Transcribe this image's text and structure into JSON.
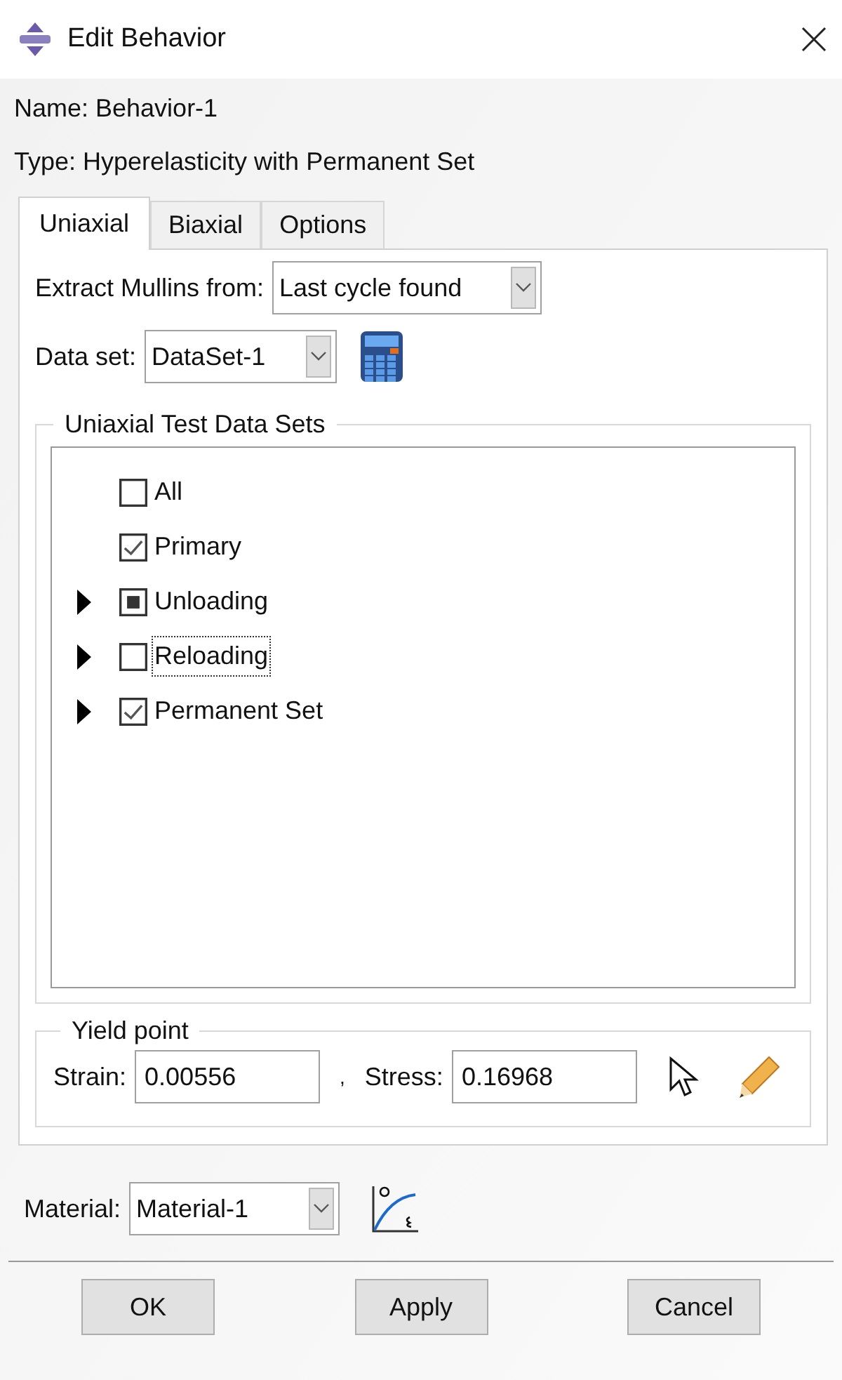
{
  "window": {
    "title": "Edit Behavior"
  },
  "name_line": "Name: Behavior-1",
  "type_line": "Type: Hyperelasticity with Permanent Set",
  "tabs": [
    {
      "label": "Uniaxial",
      "selected": true
    },
    {
      "label": "Biaxial",
      "selected": false
    },
    {
      "label": "Options",
      "selected": false
    }
  ],
  "extract": {
    "label": "Extract Mullins from:",
    "value": "Last cycle found"
  },
  "data_set": {
    "label": "Data set:",
    "value": "DataSet-1"
  },
  "test_data_sets": {
    "title": "Uniaxial Test Data Sets",
    "items": [
      {
        "label": "All",
        "checked": false,
        "partial": false,
        "expandable": false,
        "focused": false
      },
      {
        "label": "Primary",
        "checked": true,
        "partial": false,
        "expandable": false,
        "focused": false
      },
      {
        "label": "Unloading",
        "checked": false,
        "partial": true,
        "expandable": true,
        "focused": false
      },
      {
        "label": "Reloading",
        "checked": false,
        "partial": false,
        "expandable": true,
        "focused": true
      },
      {
        "label": "Permanent Set",
        "checked": true,
        "partial": false,
        "expandable": true,
        "focused": false
      }
    ]
  },
  "yield_point": {
    "title": "Yield point",
    "strain_label": "Strain:",
    "strain": "0.00556",
    "separator": ",",
    "stress_label": "Stress:",
    "stress": "0.16968"
  },
  "material": {
    "label": "Material:",
    "value": "Material-1"
  },
  "buttons": [
    "OK",
    "Apply",
    "Cancel"
  ]
}
